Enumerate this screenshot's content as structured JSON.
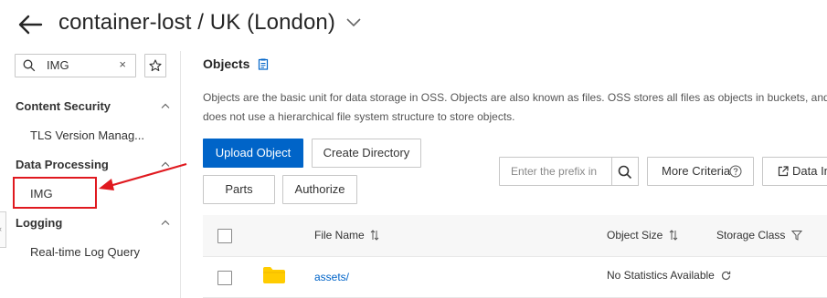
{
  "header": {
    "title": "container-lost / UK (London)"
  },
  "sidebar": {
    "search": {
      "value": "IMG",
      "clear_glyph": "×"
    },
    "sections": [
      {
        "label": "Content Security",
        "items": [
          {
            "label": "TLS Version Manag..."
          }
        ]
      },
      {
        "label": "Data Processing",
        "items": [
          {
            "label": "IMG"
          }
        ]
      },
      {
        "label": "Logging",
        "items": [
          {
            "label": "Real-time Log Query"
          }
        ]
      }
    ],
    "collapse_glyph": "‹"
  },
  "main": {
    "heading": "Objects",
    "description": "Objects are the basic unit for data storage in OSS. Objects are also known as files. OSS stores all files as objects in buckets, and does not use a hierarchical file system structure to store objects.",
    "toolbar": {
      "upload_label": "Upload Object",
      "create_dir_label": "Create Directory",
      "parts_label": "Parts",
      "authorize_label": "Authorize",
      "prefix_placeholder": "Enter the prefix in",
      "more_criteria_label": "More Criteria",
      "export_label": "Data Inde"
    },
    "table": {
      "columns": {
        "file_name": "File Name",
        "object_size": "Object Size",
        "storage_class": "Storage Class"
      },
      "rows": [
        {
          "name": "assets/",
          "size": "No Statistics Available"
        }
      ]
    }
  },
  "colors": {
    "primary": "#0064c8",
    "annotation_red": "#e0191f",
    "folder": "#ffcc00"
  }
}
